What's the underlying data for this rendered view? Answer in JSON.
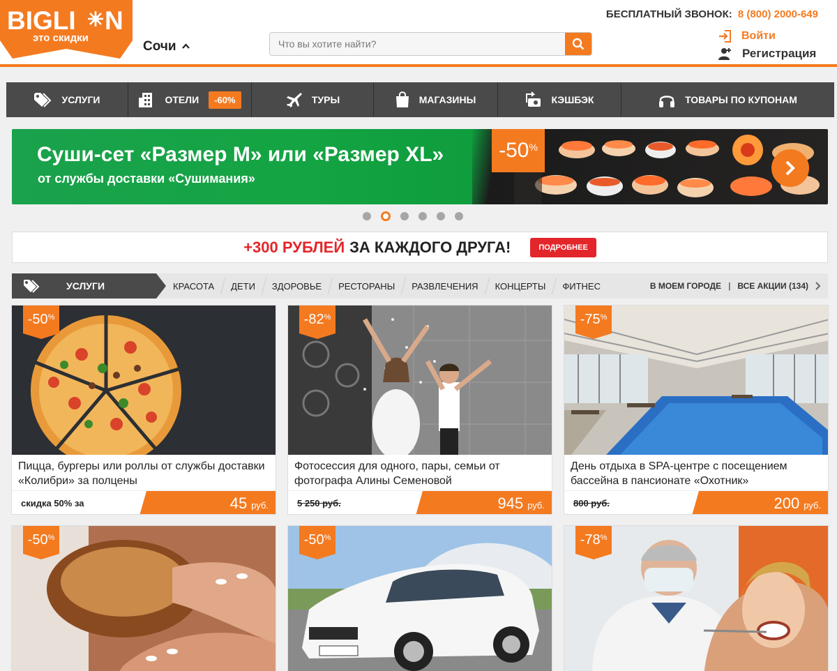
{
  "header": {
    "logo_text": "BIGLION",
    "logo_tagline": "это скидки",
    "city": "Сочи",
    "search_placeholder": "Что вы хотите найти?",
    "phone_label": "БЕСПЛАТНЫЙ ЗВОНОК:",
    "phone_number": "8 (800) 2000-649",
    "login": "Войти",
    "register": "Регистрация"
  },
  "nav": {
    "items": [
      {
        "label": "УСЛУГИ",
        "icon": "tag-icon"
      },
      {
        "label": "ОТЕЛИ",
        "icon": "building-icon",
        "badge": "-60%"
      },
      {
        "label": "ТУРЫ",
        "icon": "airplane-icon"
      },
      {
        "label": "МАГАЗИНЫ",
        "icon": "shopping-bag-icon"
      },
      {
        "label": "КЭШБЭК",
        "icon": "cashback-icon"
      },
      {
        "label": "ТОВАРЫ ПО КУПОНАМ",
        "icon": "headphones-icon"
      }
    ]
  },
  "banner": {
    "title": "Суши-сет «Размер М» или «Размер XL»",
    "subtitle": "от службы доставки «Сушимания»",
    "discount": "-50",
    "discount_unit": "%",
    "slides_total": 6,
    "active_slide": 2
  },
  "promo": {
    "highlight": "+300 РУБЛЕЙ",
    "text": "ЗА КАЖДОГО ДРУГА!",
    "button": "ПОДРОБНЕЕ"
  },
  "tabs": {
    "main": "УСЛУГИ",
    "items": [
      "КРАСОТА",
      "ДЕТИ",
      "ЗДОРОВЬЕ",
      "РЕСТОРАНЫ",
      "РАЗВЛЕЧЕНИЯ",
      "КОНЦЕРТЫ",
      "ФИТНЕС"
    ],
    "city_link": "В МОЕМ ГОРОДЕ",
    "separator": "|",
    "all_link": "ВСЕ АКЦИИ (134)"
  },
  "cards": [
    {
      "discount": "-50",
      "unit": "%",
      "title": "Пицца, бургеры или роллы от службы доставки «Колибри» за полцены",
      "old": "скидка 50% за",
      "price": "45",
      "currency": "руб."
    },
    {
      "discount": "-82",
      "unit": "%",
      "title": "Фотосессия для одного, пары, семьи от фотографа Алины Семеновой",
      "old": "5 250 руб.",
      "price": "945",
      "currency": "руб."
    },
    {
      "discount": "-75",
      "unit": "%",
      "title": "День отдыха в SPA-центре с посещением бассейна в пансионате «Охотник»",
      "old": "800 руб.",
      "price": "200",
      "currency": "руб."
    },
    {
      "discount": "-50",
      "unit": "%"
    },
    {
      "discount": "-50",
      "unit": "%"
    },
    {
      "discount": "-78",
      "unit": "%"
    }
  ],
  "colors": {
    "accent": "#f47a20",
    "nav": "#4a4a4a",
    "promo_red": "#e3262a",
    "banner_green": "#14a443"
  }
}
